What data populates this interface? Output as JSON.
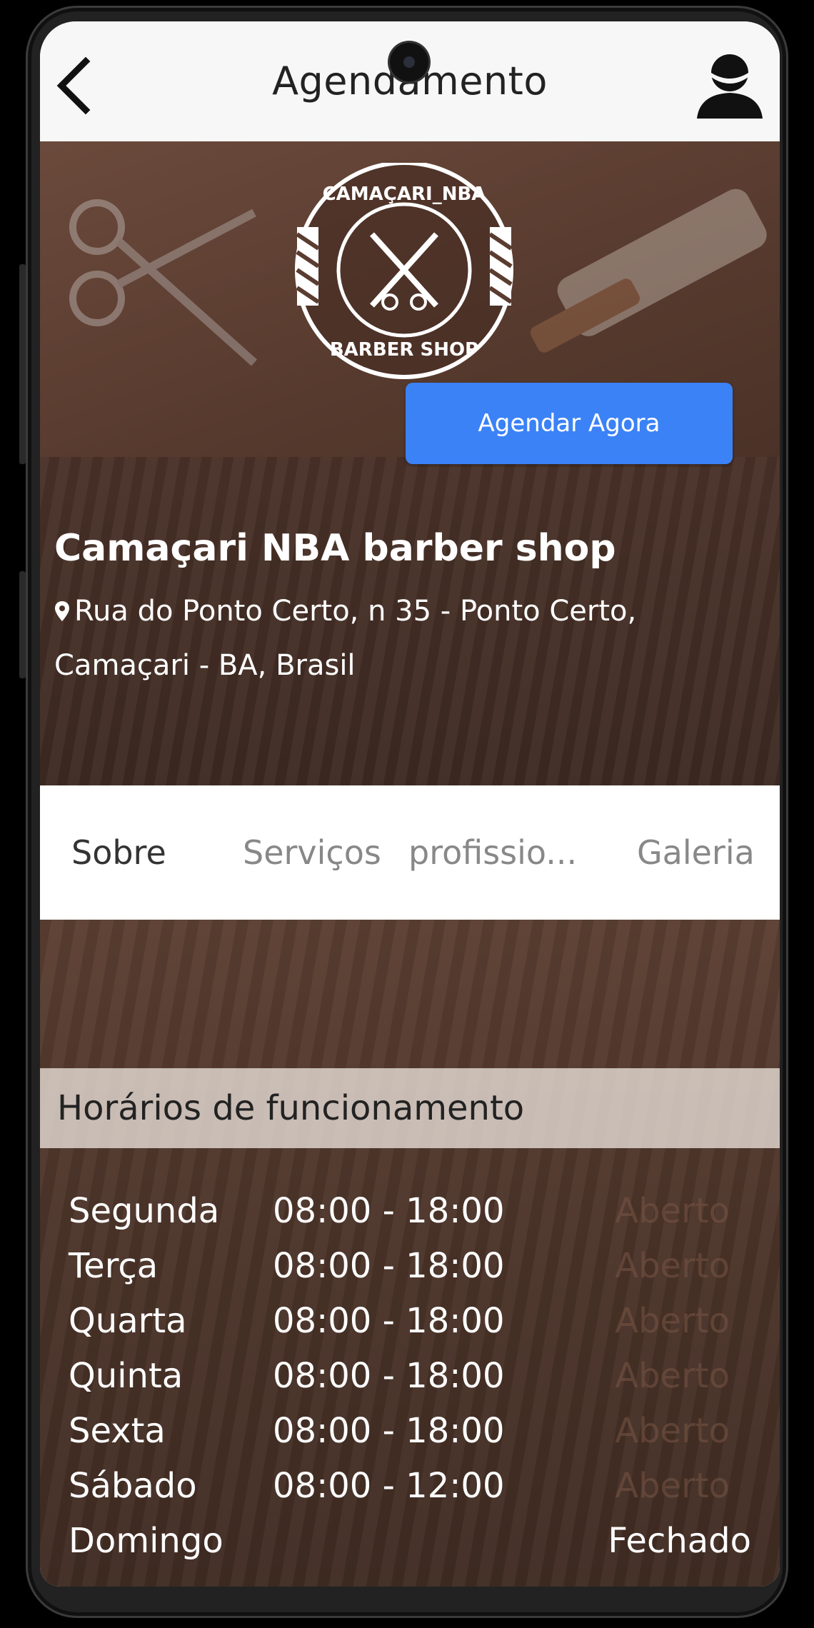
{
  "header": {
    "title": "Agendamento",
    "back_icon": "chevron-left-icon",
    "profile_icon": "user-avatar-icon"
  },
  "shop": {
    "logo_text_top": "CAMAÇARI_NBA",
    "logo_text_bottom": "BARBER SHOP",
    "name": "Camaçari NBA barber shop",
    "address": "Rua do Ponto Certo, n 35 - Ponto Certo, Camaçari - BA, Brasil",
    "book_button": "Agendar Agora"
  },
  "tabs": [
    {
      "label": "Sobre",
      "active": true
    },
    {
      "label": "Serviços",
      "active": false
    },
    {
      "label": "profissio...",
      "active": false
    },
    {
      "label": "Galeria",
      "active": false
    }
  ],
  "hours": {
    "title": "Horários de funcionamento",
    "rows": [
      {
        "day": "Segunda",
        "time": "08:00 - 18:00",
        "status": "Aberto"
      },
      {
        "day": "Terça",
        "time": "08:00 - 18:00",
        "status": "Aberto"
      },
      {
        "day": "Quarta",
        "time": "08:00 - 18:00",
        "status": "Aberto"
      },
      {
        "day": "Quinta",
        "time": "08:00 - 18:00",
        "status": "Aberto"
      },
      {
        "day": "Sexta",
        "time": "08:00 - 18:00",
        "status": "Aberto"
      },
      {
        "day": "Sábado",
        "time": "08:00 - 12:00",
        "status": "Aberto"
      },
      {
        "day": "Domingo",
        "time": "",
        "status": "Fechado"
      }
    ]
  },
  "colors": {
    "accent": "#3b82f6",
    "wood_dark": "#4a3228",
    "header_bg": "#f7f7f7"
  }
}
